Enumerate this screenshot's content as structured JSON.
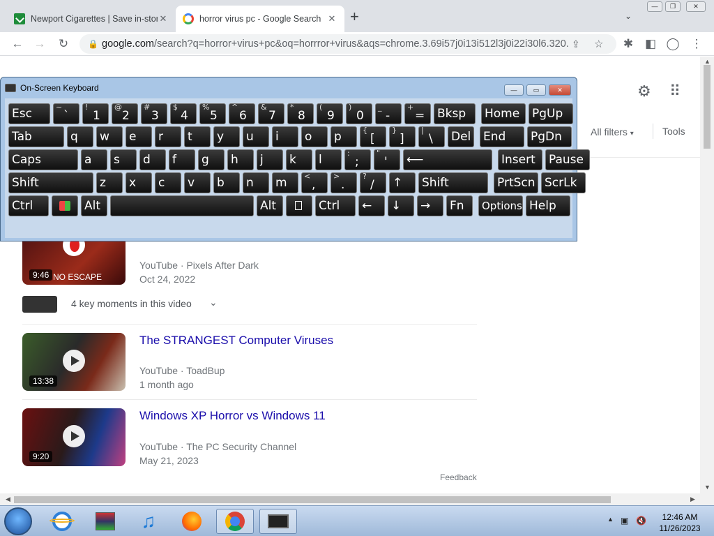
{
  "browser": {
    "tabs": [
      {
        "title": "Newport Cigarettes | Save in-store",
        "active": false
      },
      {
        "title": "horror virus pc - Google Search",
        "active": true
      }
    ],
    "new_tab": "+",
    "address": {
      "host": "google.com",
      "path": "/search?q=horror+virus+pc&oq=horrror+virus&aqs=chrome.3.69i57j0i13i512l3j0i22i30l6.320..."
    }
  },
  "search_page": {
    "all_filters": "All filters",
    "tools": "Tools",
    "key_moments": "4 key moments in this video",
    "feedback": "Feedback",
    "results": [
      {
        "title": "",
        "channel": "YouTube · Pixels After Dark",
        "date": "Oct 24, 2022",
        "duration": "9:46",
        "thumb_text": "NO ESCAPE"
      },
      {
        "title": "The STRANGEST Computer Viruses",
        "channel": "YouTube · ToadBup",
        "date": "1 month ago",
        "duration": "13:38"
      },
      {
        "title": "Windows XP Horror vs Windows 11",
        "channel": "YouTube · The PC Security Channel",
        "date": "May 21, 2023",
        "duration": "9:20"
      }
    ]
  },
  "osk": {
    "title": "On-Screen Keyboard",
    "rows": [
      [
        {
          "k": "esc",
          "label": "Esc"
        },
        {
          "k": "tilde",
          "shift": "~",
          "main": "`"
        },
        {
          "k": "1",
          "shift": "!",
          "main": "1"
        },
        {
          "k": "2",
          "shift": "@",
          "main": "2"
        },
        {
          "k": "3",
          "shift": "#",
          "main": "3"
        },
        {
          "k": "4",
          "shift": "$",
          "main": "4"
        },
        {
          "k": "5",
          "shift": "%",
          "main": "5"
        },
        {
          "k": "6",
          "shift": "^",
          "main": "6"
        },
        {
          "k": "7",
          "shift": "&",
          "main": "7"
        },
        {
          "k": "8",
          "shift": "*",
          "main": "8"
        },
        {
          "k": "9",
          "shift": "(",
          "main": "9"
        },
        {
          "k": "0",
          "shift": ")",
          "main": "0"
        },
        {
          "k": "minus",
          "shift": "_",
          "main": "-"
        },
        {
          "k": "equals",
          "shift": "+",
          "main": "="
        },
        {
          "k": "bksp",
          "label": "Bksp"
        },
        {
          "k": "home",
          "label": "Home"
        },
        {
          "k": "pgup",
          "label": "PgUp"
        }
      ],
      [
        {
          "k": "tab",
          "label": "Tab"
        },
        {
          "k": "q",
          "label": "q"
        },
        {
          "k": "w",
          "label": "w"
        },
        {
          "k": "e",
          "label": "e"
        },
        {
          "k": "r",
          "label": "r"
        },
        {
          "k": "t",
          "label": "t"
        },
        {
          "k": "y",
          "label": "y"
        },
        {
          "k": "u",
          "label": "u"
        },
        {
          "k": "i",
          "label": "i"
        },
        {
          "k": "o",
          "label": "o"
        },
        {
          "k": "p",
          "label": "p"
        },
        {
          "k": "lbracket",
          "shift": "{",
          "main": "["
        },
        {
          "k": "rbracket",
          "shift": "}",
          "main": "]"
        },
        {
          "k": "backslash",
          "shift": "|",
          "main": "\\"
        },
        {
          "k": "del",
          "label": "Del"
        },
        {
          "k": "end",
          "label": "End"
        },
        {
          "k": "pgdn",
          "label": "PgDn"
        }
      ],
      [
        {
          "k": "caps",
          "label": "Caps"
        },
        {
          "k": "a",
          "label": "a"
        },
        {
          "k": "s",
          "label": "s"
        },
        {
          "k": "d",
          "label": "d"
        },
        {
          "k": "f",
          "label": "f"
        },
        {
          "k": "g",
          "label": "g"
        },
        {
          "k": "h",
          "label": "h"
        },
        {
          "k": "j",
          "label": "j"
        },
        {
          "k": "k",
          "label": "k"
        },
        {
          "k": "l",
          "label": "l"
        },
        {
          "k": "semicolon",
          "shift": ":",
          "main": ";"
        },
        {
          "k": "quote",
          "shift": "\"",
          "main": "'"
        },
        {
          "k": "enter",
          "label": "⟵"
        },
        {
          "k": "insert",
          "label": "Insert"
        },
        {
          "k": "pause",
          "label": "Pause"
        }
      ],
      [
        {
          "k": "lshift",
          "label": "Shift"
        },
        {
          "k": "z",
          "label": "z"
        },
        {
          "k": "x",
          "label": "x"
        },
        {
          "k": "c",
          "label": "c"
        },
        {
          "k": "v",
          "label": "v"
        },
        {
          "k": "b",
          "label": "b"
        },
        {
          "k": "n",
          "label": "n"
        },
        {
          "k": "m",
          "label": "m"
        },
        {
          "k": "comma",
          "shift": "<",
          "main": ","
        },
        {
          "k": "period",
          "shift": ">",
          "main": "."
        },
        {
          "k": "slash",
          "shift": "?",
          "main": "/"
        },
        {
          "k": "up",
          "label": "↑"
        },
        {
          "k": "rshift",
          "label": "Shift"
        },
        {
          "k": "prtscn",
          "label": "PrtScn"
        },
        {
          "k": "scrlk",
          "label": "ScrLk"
        }
      ],
      [
        {
          "k": "lctrl",
          "label": "Ctrl"
        },
        {
          "k": "win",
          "label": ""
        },
        {
          "k": "lalt",
          "label": "Alt"
        },
        {
          "k": "space",
          "label": ""
        },
        {
          "k": "ralt",
          "label": "Alt"
        },
        {
          "k": "menu",
          "label": ""
        },
        {
          "k": "rctrl",
          "label": "Ctrl"
        },
        {
          "k": "left",
          "label": "←"
        },
        {
          "k": "down",
          "label": "↓"
        },
        {
          "k": "right",
          "label": "→"
        },
        {
          "k": "fn",
          "label": "Fn"
        },
        {
          "k": "options",
          "label": "Options"
        },
        {
          "k": "help",
          "label": "Help"
        }
      ]
    ]
  },
  "taskbar": {
    "apps": [
      "start-orb",
      "internet-explorer",
      "archive-manager",
      "music-player",
      "firefox",
      "chrome",
      "on-screen-keyboard"
    ],
    "time": "12:46 AM",
    "date": "11/26/2023"
  }
}
